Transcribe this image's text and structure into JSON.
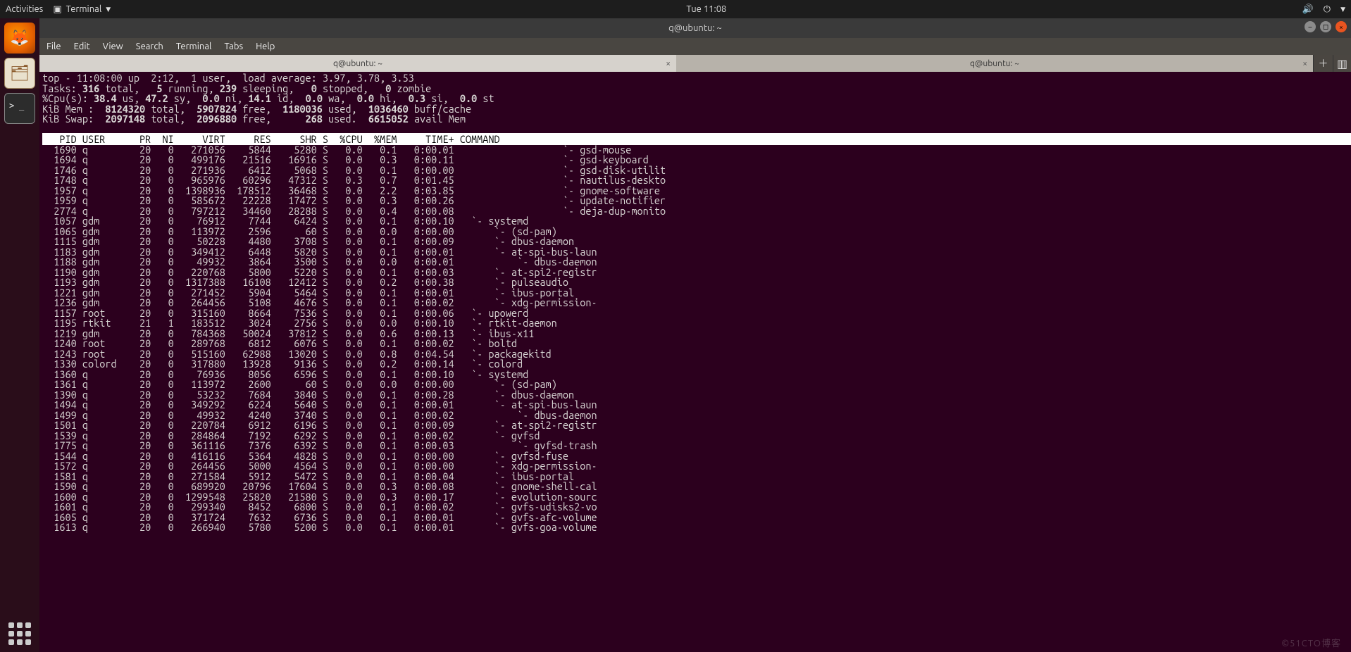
{
  "gnome": {
    "activities": "Activities",
    "app_name": "Terminal",
    "clock": "Tue 11:08"
  },
  "window": {
    "title": "q@ubuntu: ~",
    "menubar": [
      "File",
      "Edit",
      "View",
      "Search",
      "Terminal",
      "Tabs",
      "Help"
    ],
    "tabs": [
      {
        "label": "q@ubuntu: ~",
        "active": true
      },
      {
        "label": "q@ubuntu: ~",
        "active": false
      }
    ]
  },
  "top": {
    "uptime_line": "top - 11:08:00 up  2:12,  1 user,  load average: 3.97, 3.78, 3.53",
    "tasks": {
      "label": "Tasks:",
      "total": "316",
      "running": "5",
      "sleeping": "239",
      "stopped": "0",
      "zombie": "0"
    },
    "cpu": {
      "label": "%Cpu(s):",
      "us": "38.4",
      "sy": "47.2",
      "ni": "0.0",
      "id": "14.1",
      "wa": "0.0",
      "hi": "0.0",
      "si": "0.3",
      "st": "0.0"
    },
    "mem": {
      "label": "KiB Mem :",
      "total": "8124320",
      "free": "5907824",
      "used": "1180036",
      "buff": "1036460"
    },
    "swap": {
      "label": "KiB Swap:",
      "total": "2097148",
      "free": "2096880",
      "used": "268",
      "avail": "6615052"
    },
    "columns": [
      "PID",
      "USER",
      "PR",
      "NI",
      "VIRT",
      "RES",
      "SHR",
      "S",
      "%CPU",
      "%MEM",
      "TIME+",
      "COMMAND"
    ],
    "processes": [
      {
        "pid": "1690",
        "user": "q",
        "pr": "20",
        "ni": "0",
        "virt": "271056",
        "res": "5844",
        "shr": "5280",
        "s": "S",
        "cpu": "0.0",
        "mem": "0.1",
        "time": "0:00.01",
        "tree": "                  `- ",
        "cmd": "gsd-mouse"
      },
      {
        "pid": "1694",
        "user": "q",
        "pr": "20",
        "ni": "0",
        "virt": "499176",
        "res": "21516",
        "shr": "16916",
        "s": "S",
        "cpu": "0.0",
        "mem": "0.3",
        "time": "0:00.11",
        "tree": "                  `- ",
        "cmd": "gsd-keyboard"
      },
      {
        "pid": "1746",
        "user": "q",
        "pr": "20",
        "ni": "0",
        "virt": "271936",
        "res": "6412",
        "shr": "5068",
        "s": "S",
        "cpu": "0.0",
        "mem": "0.1",
        "time": "0:00.00",
        "tree": "                  `- ",
        "cmd": "gsd-disk-utilit"
      },
      {
        "pid": "1748",
        "user": "q",
        "pr": "20",
        "ni": "0",
        "virt": "965976",
        "res": "60296",
        "shr": "47312",
        "s": "S",
        "cpu": "0.3",
        "mem": "0.7",
        "time": "0:01.45",
        "tree": "                  `- ",
        "cmd": "nautilus-deskto"
      },
      {
        "pid": "1957",
        "user": "q",
        "pr": "20",
        "ni": "0",
        "virt": "1398936",
        "res": "178512",
        "shr": "36468",
        "s": "S",
        "cpu": "0.0",
        "mem": "2.2",
        "time": "0:03.85",
        "tree": "                  `- ",
        "cmd": "gnome-software"
      },
      {
        "pid": "1959",
        "user": "q",
        "pr": "20",
        "ni": "0",
        "virt": "585672",
        "res": "22228",
        "shr": "17472",
        "s": "S",
        "cpu": "0.0",
        "mem": "0.3",
        "time": "0:00.26",
        "tree": "                  `- ",
        "cmd": "update-notifier"
      },
      {
        "pid": "2774",
        "user": "q",
        "pr": "20",
        "ni": "0",
        "virt": "797212",
        "res": "34460",
        "shr": "28288",
        "s": "S",
        "cpu": "0.0",
        "mem": "0.4",
        "time": "0:00.08",
        "tree": "                  `- ",
        "cmd": "deja-dup-monito"
      },
      {
        "pid": "1057",
        "user": "gdm",
        "pr": "20",
        "ni": "0",
        "virt": "76912",
        "res": "7744",
        "shr": "6424",
        "s": "S",
        "cpu": "0.0",
        "mem": "0.1",
        "time": "0:00.10",
        "tree": "  `- ",
        "cmd": "systemd"
      },
      {
        "pid": "1065",
        "user": "gdm",
        "pr": "20",
        "ni": "0",
        "virt": "113972",
        "res": "2596",
        "shr": "60",
        "s": "S",
        "cpu": "0.0",
        "mem": "0.0",
        "time": "0:00.00",
        "tree": "      `- ",
        "cmd": "(sd-pam)"
      },
      {
        "pid": "1115",
        "user": "gdm",
        "pr": "20",
        "ni": "0",
        "virt": "50228",
        "res": "4480",
        "shr": "3708",
        "s": "S",
        "cpu": "0.0",
        "mem": "0.1",
        "time": "0:00.09",
        "tree": "      `- ",
        "cmd": "dbus-daemon"
      },
      {
        "pid": "1183",
        "user": "gdm",
        "pr": "20",
        "ni": "0",
        "virt": "349412",
        "res": "6448",
        "shr": "5820",
        "s": "S",
        "cpu": "0.0",
        "mem": "0.1",
        "time": "0:00.01",
        "tree": "      `- ",
        "cmd": "at-spi-bus-laun"
      },
      {
        "pid": "1188",
        "user": "gdm",
        "pr": "20",
        "ni": "0",
        "virt": "49932",
        "res": "3864",
        "shr": "3500",
        "s": "S",
        "cpu": "0.0",
        "mem": "0.0",
        "time": "0:00.01",
        "tree": "          `- ",
        "cmd": "dbus-daemon"
      },
      {
        "pid": "1190",
        "user": "gdm",
        "pr": "20",
        "ni": "0",
        "virt": "220768",
        "res": "5800",
        "shr": "5220",
        "s": "S",
        "cpu": "0.0",
        "mem": "0.1",
        "time": "0:00.03",
        "tree": "      `- ",
        "cmd": "at-spi2-registr"
      },
      {
        "pid": "1193",
        "user": "gdm",
        "pr": "20",
        "ni": "0",
        "virt": "1317388",
        "res": "16108",
        "shr": "12412",
        "s": "S",
        "cpu": "0.0",
        "mem": "0.2",
        "time": "0:00.38",
        "tree": "      `- ",
        "cmd": "pulseaudio"
      },
      {
        "pid": "1221",
        "user": "gdm",
        "pr": "20",
        "ni": "0",
        "virt": "271452",
        "res": "5904",
        "shr": "5464",
        "s": "S",
        "cpu": "0.0",
        "mem": "0.1",
        "time": "0:00.01",
        "tree": "      `- ",
        "cmd": "ibus-portal"
      },
      {
        "pid": "1236",
        "user": "gdm",
        "pr": "20",
        "ni": "0",
        "virt": "264456",
        "res": "5108",
        "shr": "4676",
        "s": "S",
        "cpu": "0.0",
        "mem": "0.1",
        "time": "0:00.02",
        "tree": "      `- ",
        "cmd": "xdg-permission-"
      },
      {
        "pid": "1157",
        "user": "root",
        "pr": "20",
        "ni": "0",
        "virt": "315160",
        "res": "8664",
        "shr": "7536",
        "s": "S",
        "cpu": "0.0",
        "mem": "0.1",
        "time": "0:00.06",
        "tree": "  `- ",
        "cmd": "upowerd"
      },
      {
        "pid": "1195",
        "user": "rtkit",
        "pr": "21",
        "ni": "1",
        "virt": "183512",
        "res": "3024",
        "shr": "2756",
        "s": "S",
        "cpu": "0.0",
        "mem": "0.0",
        "time": "0:00.10",
        "tree": "  `- ",
        "cmd": "rtkit-daemon"
      },
      {
        "pid": "1219",
        "user": "gdm",
        "pr": "20",
        "ni": "0",
        "virt": "784368",
        "res": "50024",
        "shr": "37812",
        "s": "S",
        "cpu": "0.0",
        "mem": "0.6",
        "time": "0:00.13",
        "tree": "  `- ",
        "cmd": "ibus-x11"
      },
      {
        "pid": "1240",
        "user": "root",
        "pr": "20",
        "ni": "0",
        "virt": "289768",
        "res": "6812",
        "shr": "6076",
        "s": "S",
        "cpu": "0.0",
        "mem": "0.1",
        "time": "0:00.02",
        "tree": "  `- ",
        "cmd": "boltd"
      },
      {
        "pid": "1243",
        "user": "root",
        "pr": "20",
        "ni": "0",
        "virt": "515160",
        "res": "62988",
        "shr": "13020",
        "s": "S",
        "cpu": "0.0",
        "mem": "0.8",
        "time": "0:04.54",
        "tree": "  `- ",
        "cmd": "packagekitd"
      },
      {
        "pid": "1330",
        "user": "colord",
        "pr": "20",
        "ni": "0",
        "virt": "317880",
        "res": "13928",
        "shr": "9136",
        "s": "S",
        "cpu": "0.0",
        "mem": "0.2",
        "time": "0:00.14",
        "tree": "  `- ",
        "cmd": "colord"
      },
      {
        "pid": "1360",
        "user": "q",
        "pr": "20",
        "ni": "0",
        "virt": "76936",
        "res": "8056",
        "shr": "6596",
        "s": "S",
        "cpu": "0.0",
        "mem": "0.1",
        "time": "0:00.10",
        "tree": "  `- ",
        "cmd": "systemd"
      },
      {
        "pid": "1361",
        "user": "q",
        "pr": "20",
        "ni": "0",
        "virt": "113972",
        "res": "2600",
        "shr": "60",
        "s": "S",
        "cpu": "0.0",
        "mem": "0.0",
        "time": "0:00.00",
        "tree": "      `- ",
        "cmd": "(sd-pam)"
      },
      {
        "pid": "1390",
        "user": "q",
        "pr": "20",
        "ni": "0",
        "virt": "53232",
        "res": "7684",
        "shr": "3840",
        "s": "S",
        "cpu": "0.0",
        "mem": "0.1",
        "time": "0:00.28",
        "tree": "      `- ",
        "cmd": "dbus-daemon"
      },
      {
        "pid": "1494",
        "user": "q",
        "pr": "20",
        "ni": "0",
        "virt": "349292",
        "res": "6224",
        "shr": "5640",
        "s": "S",
        "cpu": "0.0",
        "mem": "0.1",
        "time": "0:00.01",
        "tree": "      `- ",
        "cmd": "at-spi-bus-laun"
      },
      {
        "pid": "1499",
        "user": "q",
        "pr": "20",
        "ni": "0",
        "virt": "49932",
        "res": "4240",
        "shr": "3740",
        "s": "S",
        "cpu": "0.0",
        "mem": "0.1",
        "time": "0:00.02",
        "tree": "          `- ",
        "cmd": "dbus-daemon"
      },
      {
        "pid": "1501",
        "user": "q",
        "pr": "20",
        "ni": "0",
        "virt": "220784",
        "res": "6912",
        "shr": "6196",
        "s": "S",
        "cpu": "0.0",
        "mem": "0.1",
        "time": "0:00.09",
        "tree": "      `- ",
        "cmd": "at-spi2-registr"
      },
      {
        "pid": "1539",
        "user": "q",
        "pr": "20",
        "ni": "0",
        "virt": "284864",
        "res": "7192",
        "shr": "6292",
        "s": "S",
        "cpu": "0.0",
        "mem": "0.1",
        "time": "0:00.02",
        "tree": "      `- ",
        "cmd": "gvfsd"
      },
      {
        "pid": "1775",
        "user": "q",
        "pr": "20",
        "ni": "0",
        "virt": "361116",
        "res": "7376",
        "shr": "6392",
        "s": "S",
        "cpu": "0.0",
        "mem": "0.1",
        "time": "0:00.03",
        "tree": "          `- ",
        "cmd": "gvfsd-trash"
      },
      {
        "pid": "1544",
        "user": "q",
        "pr": "20",
        "ni": "0",
        "virt": "416116",
        "res": "5364",
        "shr": "4828",
        "s": "S",
        "cpu": "0.0",
        "mem": "0.1",
        "time": "0:00.00",
        "tree": "      `- ",
        "cmd": "gvfsd-fuse"
      },
      {
        "pid": "1572",
        "user": "q",
        "pr": "20",
        "ni": "0",
        "virt": "264456",
        "res": "5000",
        "shr": "4564",
        "s": "S",
        "cpu": "0.0",
        "mem": "0.1",
        "time": "0:00.00",
        "tree": "      `- ",
        "cmd": "xdg-permission-"
      },
      {
        "pid": "1581",
        "user": "q",
        "pr": "20",
        "ni": "0",
        "virt": "271584",
        "res": "5912",
        "shr": "5472",
        "s": "S",
        "cpu": "0.0",
        "mem": "0.1",
        "time": "0:00.04",
        "tree": "      `- ",
        "cmd": "ibus-portal"
      },
      {
        "pid": "1590",
        "user": "q",
        "pr": "20",
        "ni": "0",
        "virt": "689920",
        "res": "20796",
        "shr": "17604",
        "s": "S",
        "cpu": "0.0",
        "mem": "0.3",
        "time": "0:00.08",
        "tree": "      `- ",
        "cmd": "gnome-shell-cal"
      },
      {
        "pid": "1600",
        "user": "q",
        "pr": "20",
        "ni": "0",
        "virt": "1299548",
        "res": "25820",
        "shr": "21580",
        "s": "S",
        "cpu": "0.0",
        "mem": "0.3",
        "time": "0:00.17",
        "tree": "      `- ",
        "cmd": "evolution-sourc"
      },
      {
        "pid": "1601",
        "user": "q",
        "pr": "20",
        "ni": "0",
        "virt": "299340",
        "res": "8452",
        "shr": "6800",
        "s": "S",
        "cpu": "0.0",
        "mem": "0.1",
        "time": "0:00.02",
        "tree": "      `- ",
        "cmd": "gvfs-udisks2-vo"
      },
      {
        "pid": "1605",
        "user": "q",
        "pr": "20",
        "ni": "0",
        "virt": "371724",
        "res": "7632",
        "shr": "6736",
        "s": "S",
        "cpu": "0.0",
        "mem": "0.1",
        "time": "0:00.01",
        "tree": "      `- ",
        "cmd": "gvfs-afc-volume"
      },
      {
        "pid": "1613",
        "user": "q",
        "pr": "20",
        "ni": "0",
        "virt": "266940",
        "res": "5780",
        "shr": "5200",
        "s": "S",
        "cpu": "0.0",
        "mem": "0.1",
        "time": "0:00.01",
        "tree": "      `- ",
        "cmd": "gvfs-goa-volume"
      }
    ]
  },
  "watermark": "©51CTO博客"
}
